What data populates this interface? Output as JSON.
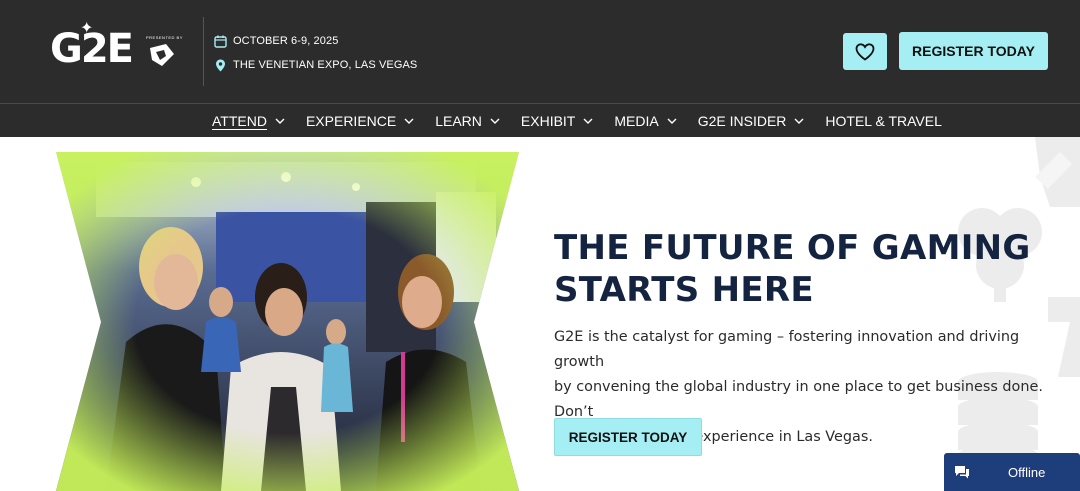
{
  "header": {
    "logo": {
      "text": "G2E",
      "badge": "PRESENTED BY"
    },
    "date": "OCTOBER 6-9, 2025",
    "location": "THE VENETIAN EXPO, LAS VEGAS",
    "register_label": "REGISTER TODAY"
  },
  "nav": {
    "items": [
      {
        "label": "ATTEND",
        "dropdown": true
      },
      {
        "label": "EXPERIENCE",
        "dropdown": true
      },
      {
        "label": "LEARN",
        "dropdown": true
      },
      {
        "label": "EXHIBIT",
        "dropdown": true
      },
      {
        "label": "MEDIA",
        "dropdown": true
      },
      {
        "label": "G2E INSIDER",
        "dropdown": true
      },
      {
        "label": "HOTEL & TRAVEL",
        "dropdown": false
      }
    ]
  },
  "hero": {
    "headline_line1": "THE FUTURE OF GAMING",
    "headline_line2": "STARTS HERE",
    "paragraph_line1": "G2E is the catalyst for gaming – fostering innovation and driving growth",
    "paragraph_line2": "by convening the global industry in one place to get business done. Don’t",
    "paragraph_line3": "miss this all-in-one experience in Las Vegas.",
    "register_label": "REGISTER TODAY"
  },
  "chat": {
    "label": "Offline"
  },
  "colors": {
    "header_bg": "#2d2c2c",
    "accent_button": "#a5eef3",
    "headline": "#142340",
    "photo_glow": "#c8f25a",
    "chat_bg": "#1e3d7b"
  },
  "icons": [
    "calendar-icon",
    "location-pin-icon",
    "heart-icon",
    "chevron-down-icon",
    "chat-icon"
  ]
}
